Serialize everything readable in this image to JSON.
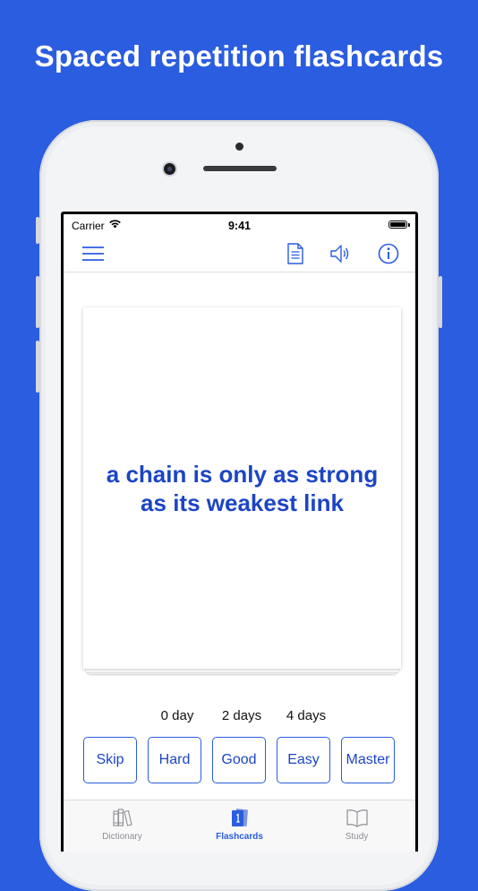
{
  "headline": "Spaced repetition flashcards",
  "status_bar": {
    "carrier": "Carrier",
    "time": "9:41"
  },
  "nav": {
    "icons": [
      "menu-icon",
      "document-icon",
      "speaker-icon",
      "info-icon"
    ]
  },
  "card": {
    "text": "a chain is only as strong as its weakest link"
  },
  "intervals": [
    "0 day",
    "2 days",
    "4 days"
  ],
  "buttons": [
    "Skip",
    "Hard",
    "Good",
    "Easy",
    "Master"
  ],
  "tabs": [
    {
      "label": "Dictionary",
      "icon": "books-icon",
      "active": false
    },
    {
      "label": "Flashcards",
      "icon": "flashcards-icon",
      "active": true
    },
    {
      "label": "Study",
      "icon": "open-book-icon",
      "active": false
    }
  ],
  "colors": {
    "background": "#2b5de0",
    "accent": "#1c45c4",
    "inactive": "#8e8e93"
  }
}
